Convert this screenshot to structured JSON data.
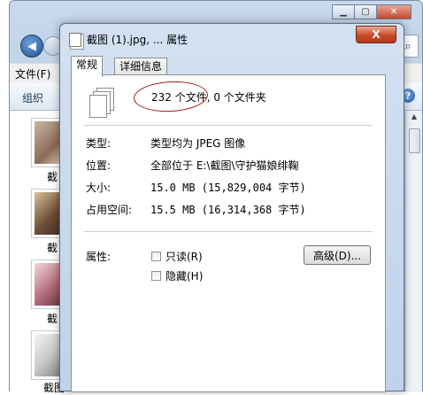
{
  "explorer": {
    "menu_label": "文件(F)",
    "organize_label": "组织",
    "thumb_caption": "截",
    "last_thumb_caption": "截图",
    "help_glyph": "?",
    "search_glyph": "⌕"
  },
  "dialog": {
    "title": "截图 (1).jpg, ... 属性",
    "close_label": "X",
    "tabs": [
      "常规",
      "详细信息"
    ],
    "summary": "232 个文件, 0 个文件夹",
    "rows": {
      "type": {
        "label": "类型:",
        "value": "类型均为 JPEG 图像"
      },
      "location": {
        "label": "位置:",
        "value": "全部位于 E:\\截图\\守护猫娘绯鞠"
      },
      "size": {
        "label": "大小:",
        "value": "15.0 MB (15,829,004 字节)"
      },
      "disk_size": {
        "label": "占用空间:",
        "value": "15.5 MB (16,314,368 字节)"
      }
    },
    "attributes_label": "属性:",
    "readonly_label": "只读(R)",
    "hidden_label": "隐藏(H)",
    "advanced_label": "高级(D)..."
  },
  "colors": {
    "annotation_circle": "#a11818",
    "title_gradient_top": "#d3e1f1"
  }
}
